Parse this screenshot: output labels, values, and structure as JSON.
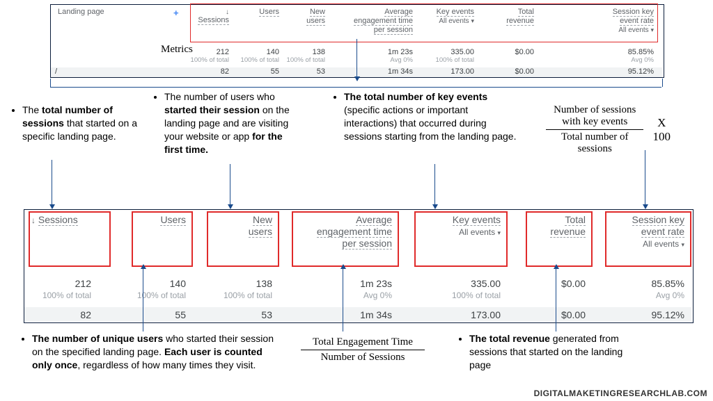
{
  "topTable": {
    "landingPageLabel": "Landing page",
    "metricsLabel": "Metrics",
    "slash": "/",
    "headers": {
      "sessions": "Sessions",
      "users": "Users",
      "newUsers": "New\nusers",
      "avgEng": "Average\nengagement time\nper session",
      "keyEvents": "Key events",
      "keyEventsDD": "All events",
      "totalRev": "Total\nrevenue",
      "skRate": "Session key\nevent rate",
      "skRateDD": "All events"
    },
    "totals": {
      "sessions": "212",
      "sessionsSub": "100% of total",
      "users": "140",
      "usersSub": "100% of total",
      "newUsers": "138",
      "newUsersSub": "100% of total",
      "avgEng": "1m 23s",
      "avgEngSub": "Avg 0%",
      "keyEvents": "335.00",
      "keyEventsSub": "100% of total",
      "totalRev": "$0.00",
      "skRate": "85.85%",
      "skRateSub": "Avg 0%"
    },
    "row": {
      "sessions": "82",
      "users": "55",
      "newUsers": "53",
      "avgEng": "1m 34s",
      "keyEvents": "173.00",
      "totalRev": "$0.00",
      "skRate": "95.12%"
    }
  },
  "bullets": {
    "sessions_pre": "The ",
    "sessions_b": "total number of sessions",
    "sessions_post": " that started on a specific landing page.",
    "newusers_pre": "The number of users who ",
    "newusers_b1": "started their session",
    "newusers_mid": " on the landing page and are visiting your website or app ",
    "newusers_b2": "for the first time.",
    "keyevents_pre": "",
    "keyevents_b": "The total number of key events",
    "keyevents_post": " (specific actions or important interactions) that occurred during sessions starting from the landing page.",
    "users_b": "The number of unique users",
    "users_mid": " who started their session on the specified landing page. ",
    "users_b2": "Each user is counted only once",
    "users_post": ", regardless of how many times they visit.",
    "revenue_b": "The total revenue",
    "revenue_post": " generated from sessions that started on the landing page"
  },
  "formulas": {
    "rateTop": "Number of sessions\nwith key events",
    "rateBot": "Total number of sessions",
    "rateX": "X 100",
    "engTop": "Total Engagement Time",
    "engBot": "Number of Sessions"
  },
  "bottomTable": {
    "headers": {
      "sessions": "Sessions",
      "users": "Users",
      "newUsers": "New\nusers",
      "avgEng": "Average\nengagement time\nper session",
      "keyEvents": "Key events",
      "keyEventsDD": "All events",
      "totalRev": "Total\nrevenue",
      "skRate": "Session key\nevent rate",
      "skRateDD": "All events"
    },
    "totals": {
      "sessions": "212",
      "sessionsSub": "100% of total",
      "users": "140",
      "usersSub": "100% of total",
      "newUsers": "138",
      "newUsersSub": "100% of total",
      "avgEng": "1m 23s",
      "avgEngSub": "Avg 0%",
      "keyEvents": "335.00",
      "keyEventsSub": "100% of total",
      "totalRev": "$0.00",
      "skRate": "85.85%",
      "skRateSub": "Avg 0%"
    },
    "row": {
      "sessions": "82",
      "users": "55",
      "newUsers": "53",
      "avgEng": "1m 34s",
      "keyEvents": "173.00",
      "totalRev": "$0.00",
      "skRate": "95.12%"
    }
  },
  "arrowDown": "↓",
  "watermark": "DIGITALMAKETINGRESEARCHLAB.COM"
}
